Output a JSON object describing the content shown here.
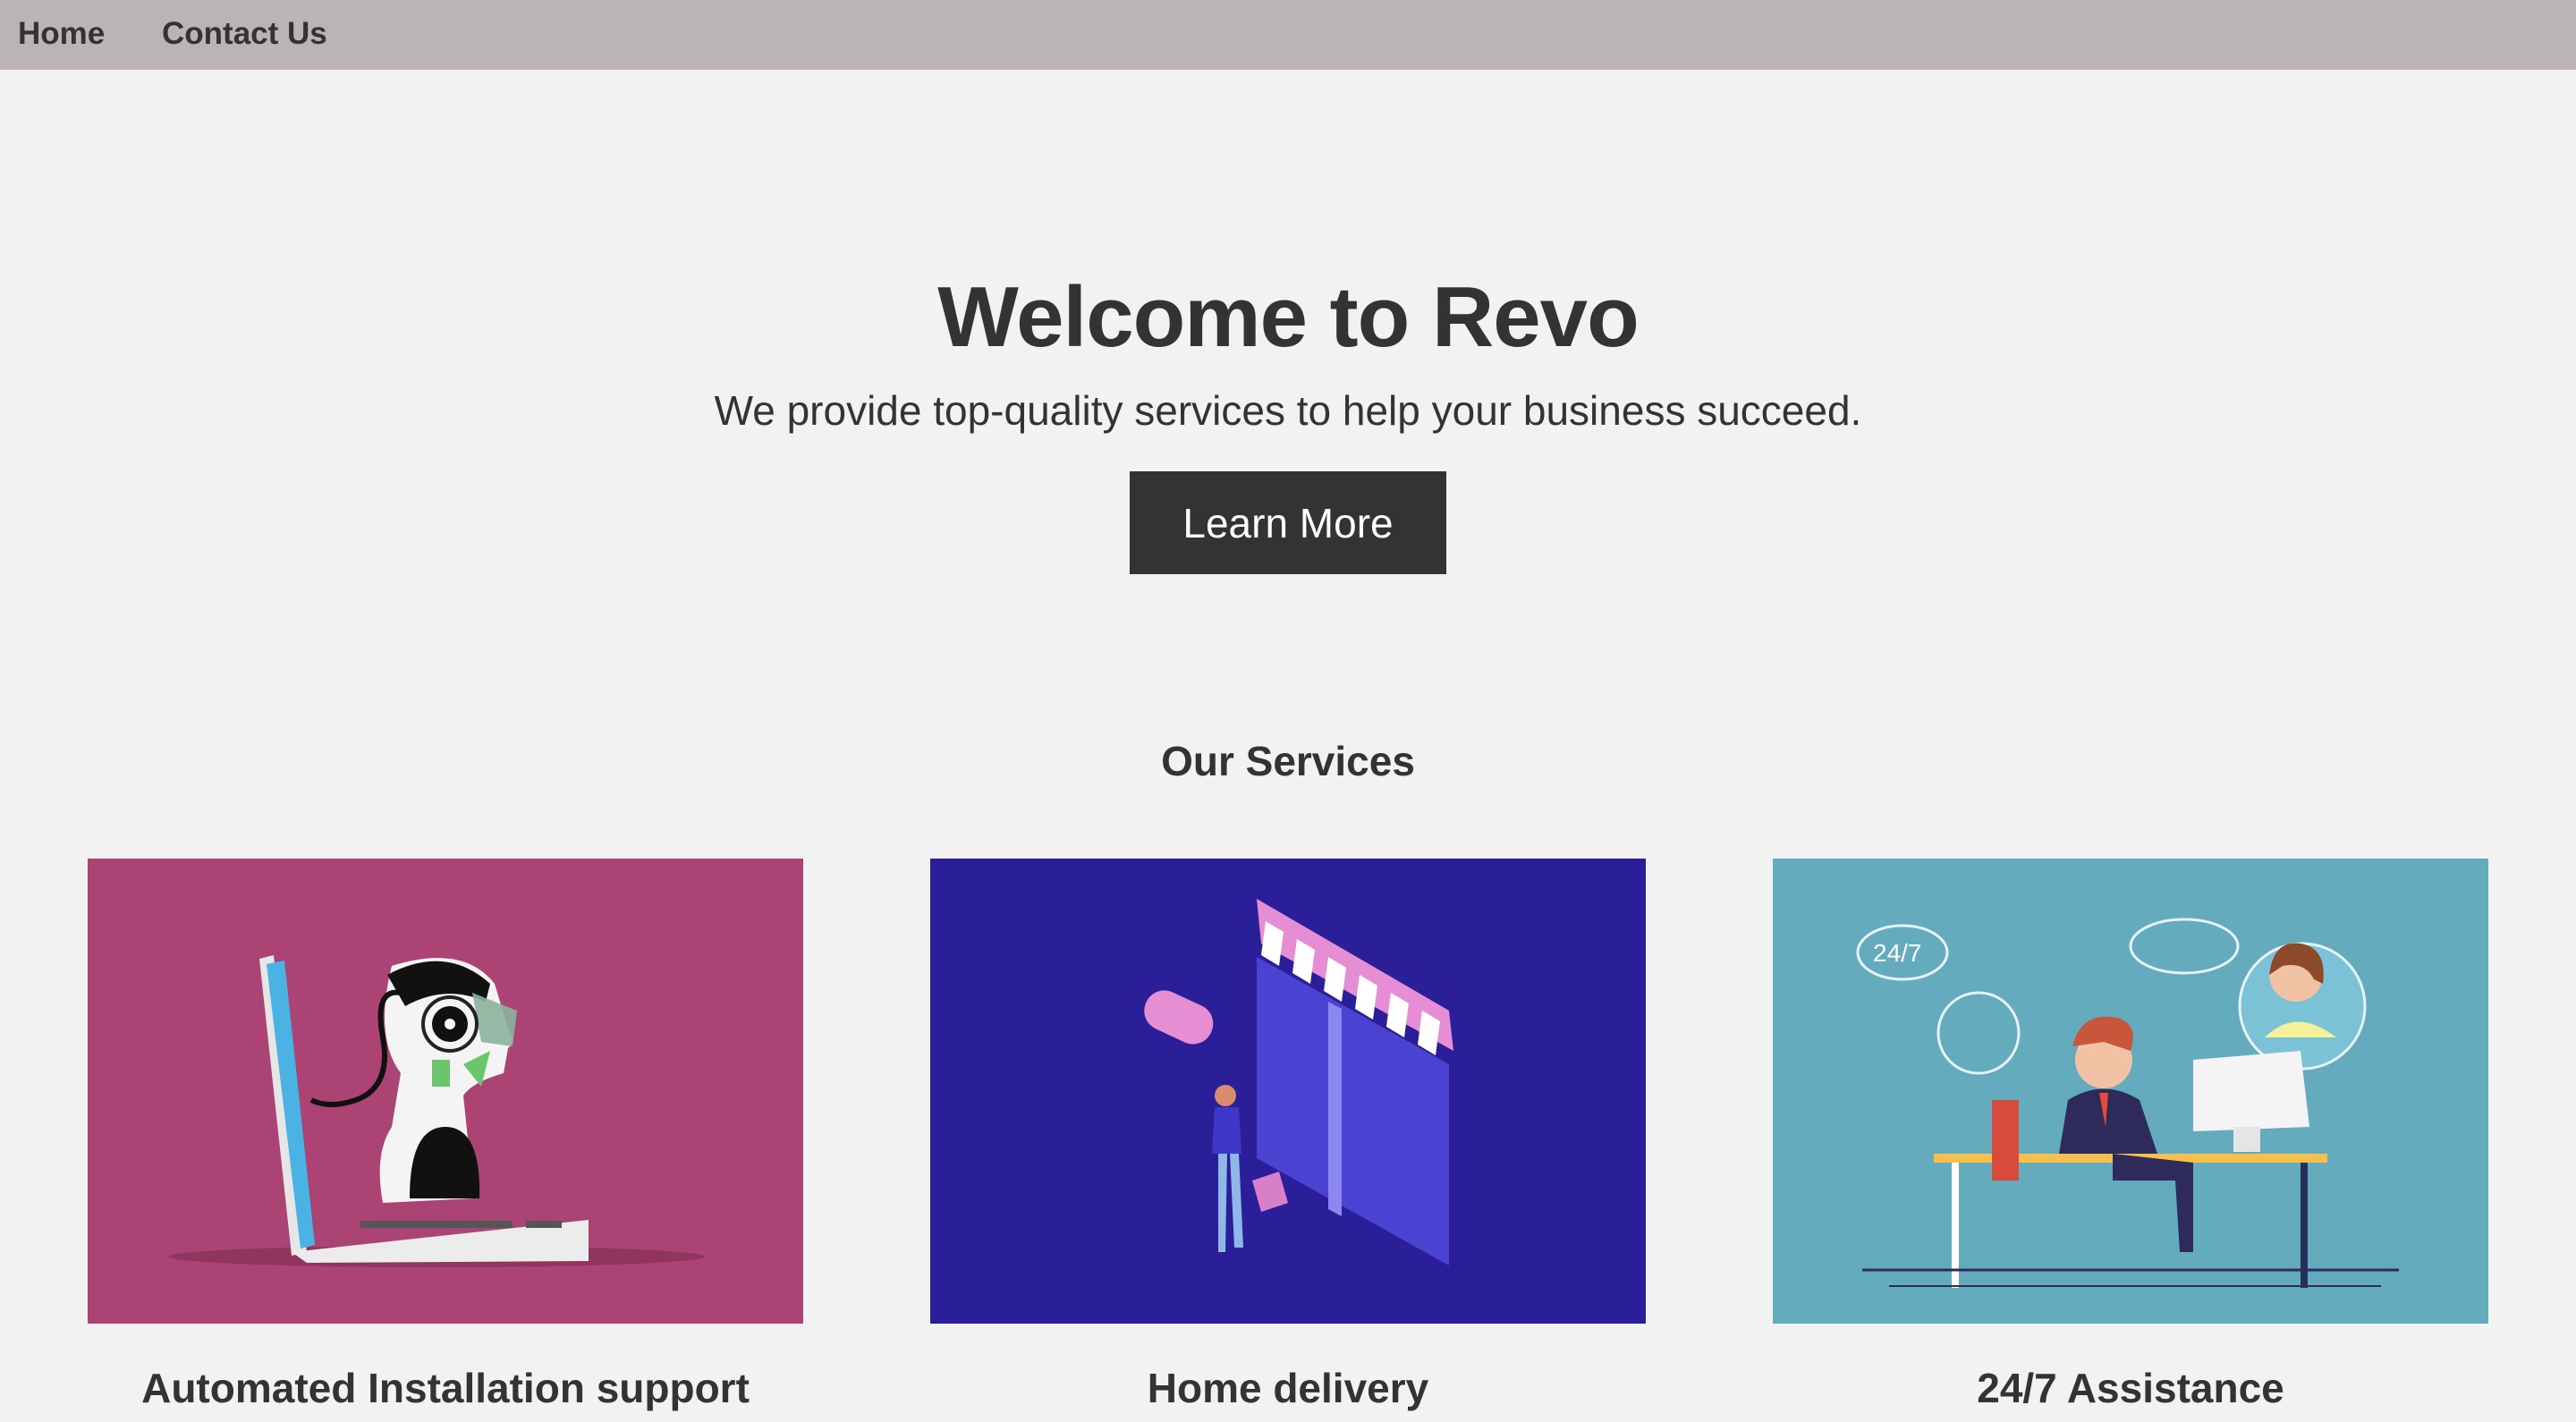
{
  "nav": {
    "home": "Home",
    "contact": "Contact Us"
  },
  "hero": {
    "title": "Welcome to Revo",
    "subtitle": "We provide top-quality services to help your business succeed.",
    "button": "Learn More"
  },
  "services": {
    "heading": "Our Services",
    "items": [
      {
        "title": "Automated Installation support",
        "image": "robot-laptop-illustration",
        "bg": "#ab4475"
      },
      {
        "title": "Home delivery",
        "image": "storefront-shopper-illustration",
        "bg": "#2b1f99"
      },
      {
        "title": "24/7 Assistance",
        "image": "support-agent-desk-illustration",
        "bg": "#64abbd",
        "badge": "24/7"
      }
    ]
  },
  "colors": {
    "navbar": "#bab4b4",
    "background": "#f2f2f2",
    "text": "#333333",
    "button": "#333333"
  }
}
